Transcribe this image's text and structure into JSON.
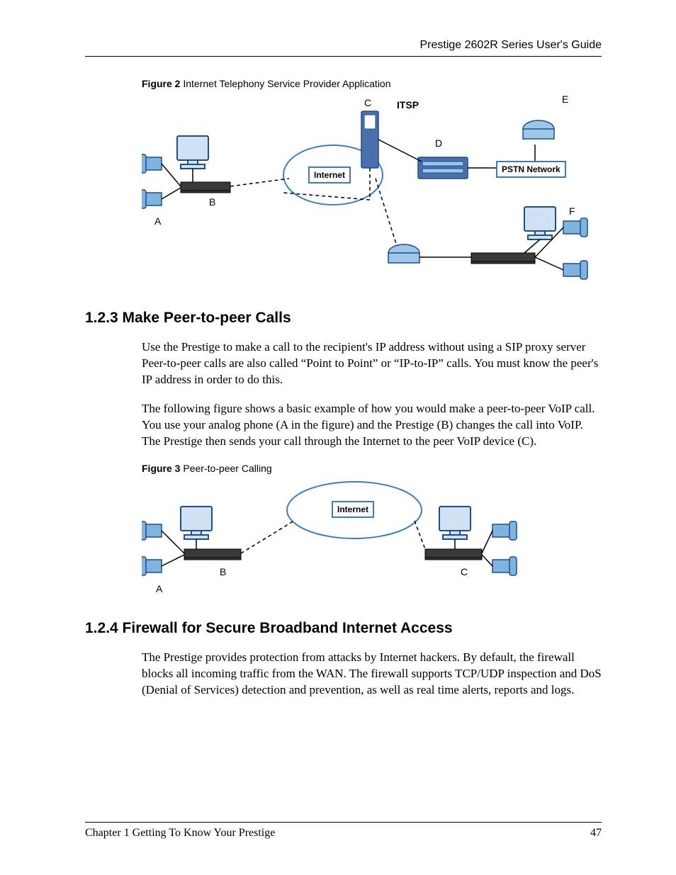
{
  "header": {
    "running_title": "Prestige 2602R Series User's Guide"
  },
  "figure2": {
    "caption_bold": "Figure 2",
    "caption_rest": "   Internet Telephony Service Provider Application",
    "labels": {
      "A": "A",
      "B": "B",
      "C": "C",
      "D": "D",
      "E": "E",
      "F": "F",
      "ITSP": "ITSP",
      "Internet": "Internet",
      "PSTN": "PSTN Network"
    }
  },
  "section123": {
    "heading": "1.2.3  Make Peer-to-peer Calls",
    "p1": "Use the Prestige to make a call to the recipient's IP address without using a SIP proxy server Peer-to-peer calls are also called “Point to Point” or “IP-to-IP” calls. You must know the peer's IP address in order to do this.",
    "p2": "The following figure shows a basic example of how you would make a peer-to-peer VoIP call. You use your analog phone (A in the figure) and the Prestige (B) changes the call into VoIP. The Prestige then sends your call through the Internet to the peer VoIP device (C)."
  },
  "figure3": {
    "caption_bold": "Figure 3",
    "caption_rest": "   Peer-to-peer Calling",
    "labels": {
      "A": "A",
      "B": "B",
      "C": "C",
      "Internet": "Internet"
    }
  },
  "section124": {
    "heading": "1.2.4  Firewall for Secure Broadband Internet Access",
    "p1": "The Prestige provides protection from attacks by Internet hackers. By default, the firewall blocks all incoming traffic from the WAN. The firewall supports TCP/UDP inspection and DoS (Denial of Services) detection and prevention, as well as real time alerts, reports and logs."
  },
  "footer": {
    "chapter": "Chapter 1 Getting To Know Your Prestige",
    "page": "47"
  }
}
